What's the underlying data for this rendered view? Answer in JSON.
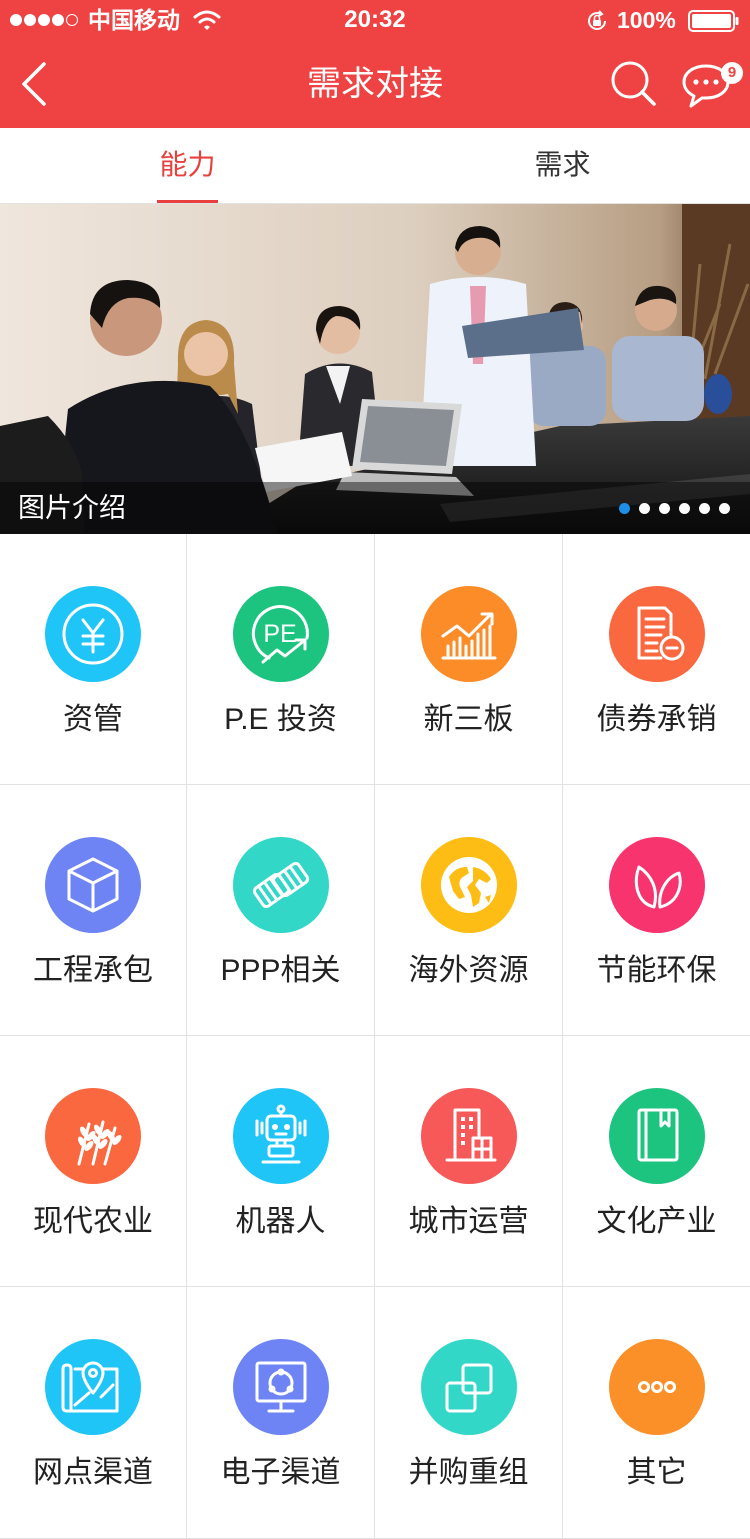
{
  "colors": {
    "primary": "#ef4242",
    "tab_active": "#e8403f",
    "banner_dot_active": "#1e8fe8"
  },
  "status_bar": {
    "signal_filled": 4,
    "signal_total": 5,
    "carrier": "中国移动",
    "time": "20:32",
    "battery": "100%",
    "icons": [
      "wifi-icon",
      "rotation-lock-icon",
      "battery-icon"
    ]
  },
  "nav": {
    "title": "需求对接",
    "back_icon": "back-chevron-icon",
    "search_icon": "search-icon",
    "message_icon": "message-icon",
    "message_badge": "9"
  },
  "tabs": [
    {
      "label": "能力",
      "active": true
    },
    {
      "label": "需求",
      "active": false
    }
  ],
  "banner": {
    "caption": "图片介绍",
    "dot_count": 6,
    "active_dot": 0
  },
  "grid": {
    "items": [
      {
        "label": "资管",
        "icon": "yen-coin-icon",
        "color": "#1fc5f6"
      },
      {
        "label": "P.E 投资",
        "icon": "pe-growth-icon",
        "color": "#1dc47f",
        "icon_text": "PE"
      },
      {
        "label": "新三板",
        "icon": "bar-chart-icon",
        "color": "#fb8c27"
      },
      {
        "label": "债券承销",
        "icon": "bond-document-icon",
        "color": "#f9683f"
      },
      {
        "label": "工程承包",
        "icon": "cube-icon",
        "color": "#6e84f5"
      },
      {
        "label": "PPP相关",
        "icon": "handshake-icon",
        "color": "#33d7c8"
      },
      {
        "label": "海外资源",
        "icon": "globe-icon",
        "color": "#fdbd14"
      },
      {
        "label": "节能环保",
        "icon": "leaf-icon",
        "color": "#f7346d"
      },
      {
        "label": "现代农业",
        "icon": "wheat-icon",
        "color": "#f9683f"
      },
      {
        "label": "机器人",
        "icon": "robot-icon",
        "color": "#1fc5f6"
      },
      {
        "label": "城市运营",
        "icon": "building-icon",
        "color": "#f75858"
      },
      {
        "label": "文化产业",
        "icon": "book-icon",
        "color": "#1dc47f"
      },
      {
        "label": "网点渠道",
        "icon": "map-pin-icon",
        "color": "#1fc5f6"
      },
      {
        "label": "电子渠道",
        "icon": "monitor-share-icon",
        "color": "#6e84f5"
      },
      {
        "label": "并购重组",
        "icon": "overlap-squares-icon",
        "color": "#33d7c8"
      },
      {
        "label": "其它",
        "icon": "more-dots-icon",
        "color": "#fb9028"
      }
    ]
  }
}
